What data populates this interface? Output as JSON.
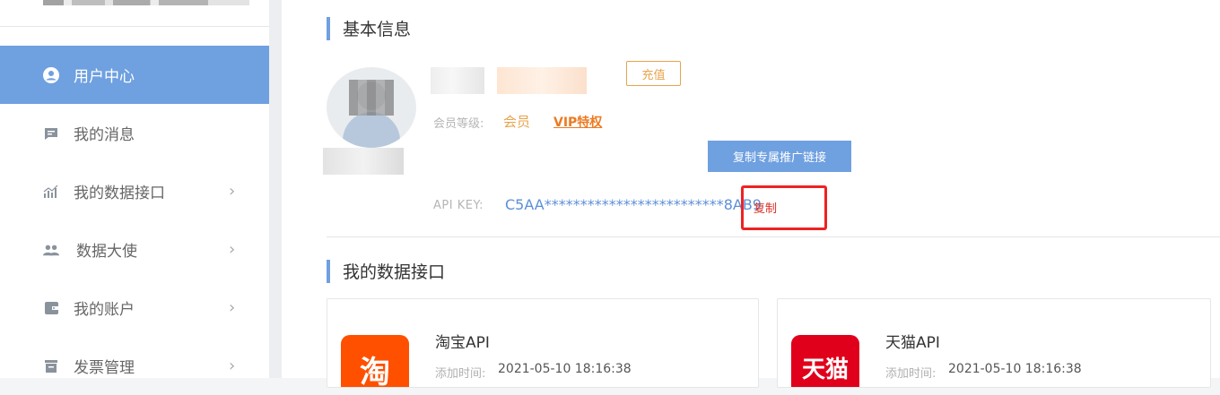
{
  "sidebar": {
    "items": [
      {
        "label": "用户中心",
        "icon": "user-circle-icon"
      },
      {
        "label": "我的消息",
        "icon": "message-icon"
      },
      {
        "label": "我的数据接口",
        "icon": "chart-bars-icon"
      },
      {
        "label": "数据大使",
        "icon": "users-icon"
      },
      {
        "label": "我的账户",
        "icon": "wallet-icon"
      },
      {
        "label": "发票管理",
        "icon": "invoice-icon"
      }
    ],
    "chevron": "›"
  },
  "basic_info": {
    "title": "基本信息",
    "recharge_label": "充值",
    "member_level_label": "会员等级:",
    "member_level_value": "会员",
    "vip_link": "VIP特权",
    "promo_button": "复制专属推广链接",
    "api_key_label": "API KEY:",
    "api_key_value": "C5AA*************************8AB9",
    "copy_label": "复制"
  },
  "interfaces": {
    "title": "我的数据接口",
    "cards": [
      {
        "name": "淘宝API",
        "logo_text": "淘",
        "logo_color": "#ff5000",
        "date_label": "添加时间:",
        "date_value": "2021-05-10 18:16:38"
      },
      {
        "name": "天猫API",
        "logo_text": "天猫",
        "logo_color": "#e0001b",
        "date_label": "添加时间:",
        "date_value": "2021-05-10 18:16:38"
      }
    ]
  },
  "colors": {
    "accent": "#6fa0e0",
    "orange": "#e7a44d",
    "highlight": "#ee2222"
  }
}
